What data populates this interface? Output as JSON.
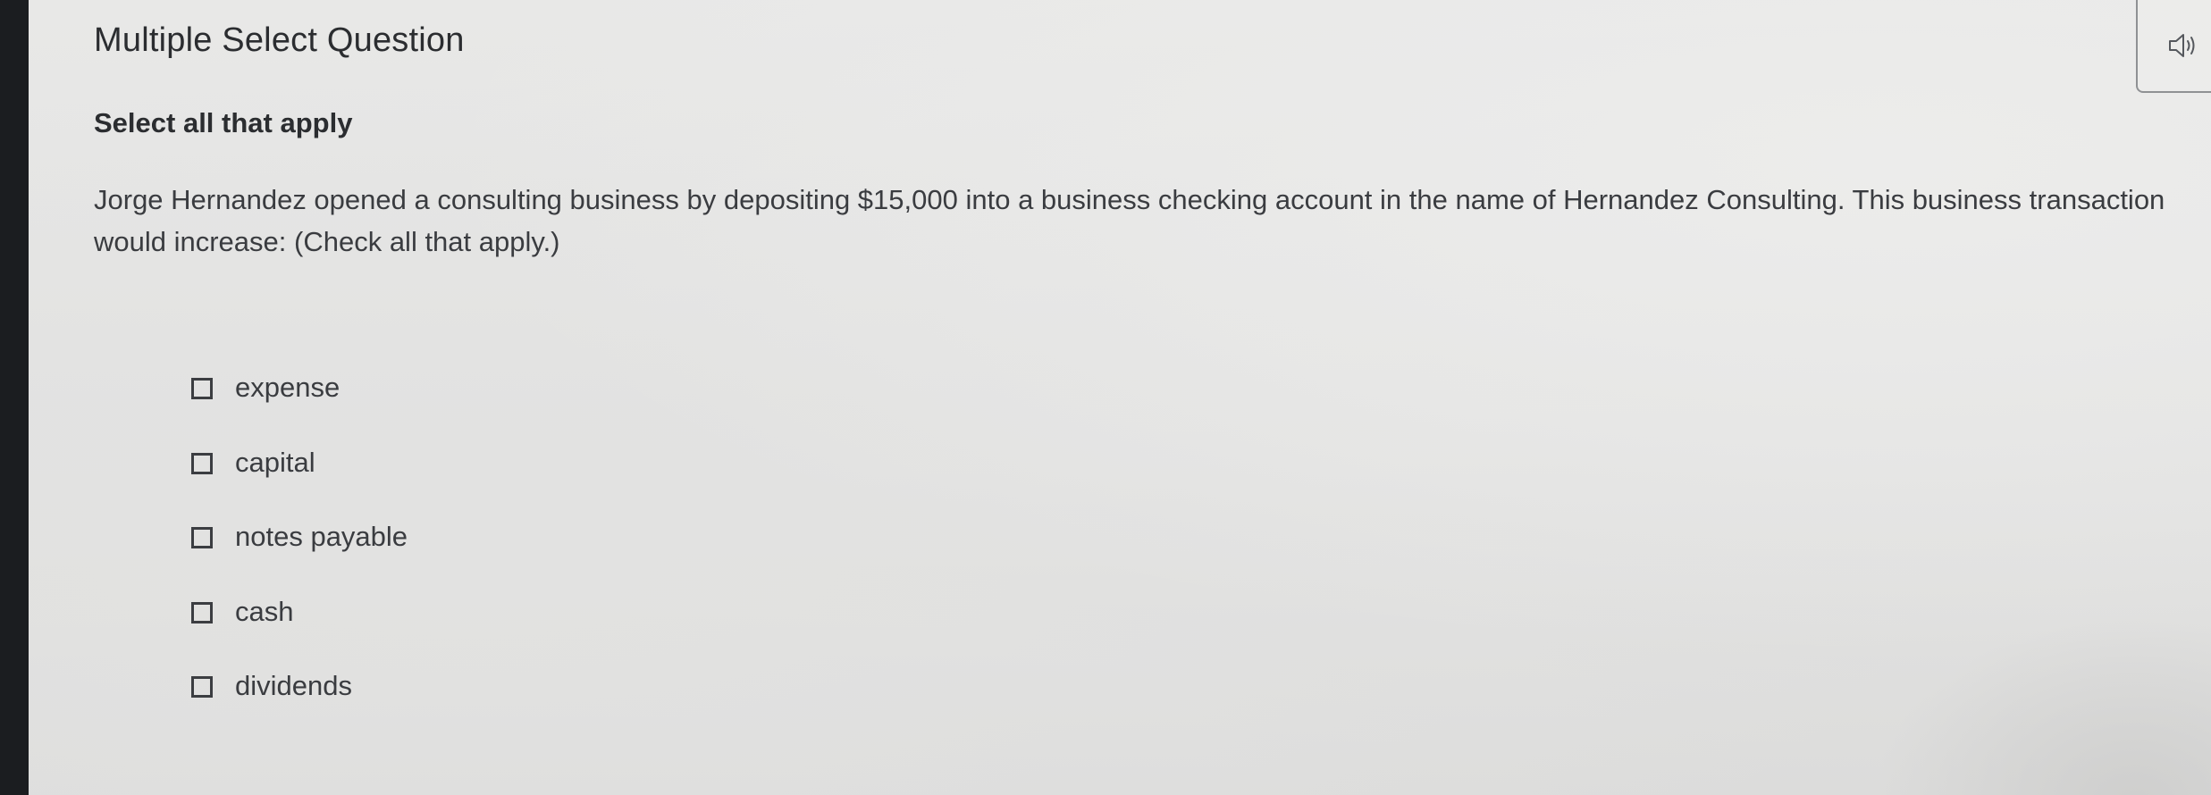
{
  "question": {
    "type_label": "Multiple Select Question",
    "instruction": "Select all that apply",
    "prompt": "Jorge Hernandez opened a consulting business by depositing $15,000 into a business checking account in the name of Hernandez Consulting. This business transaction would increase: (Check all that apply.)"
  },
  "audio": {
    "icon": "speaker-icon"
  },
  "options": [
    {
      "label": "expense",
      "checked": false
    },
    {
      "label": "capital",
      "checked": false
    },
    {
      "label": "notes payable",
      "checked": false
    },
    {
      "label": "cash",
      "checked": false
    },
    {
      "label": "dividends",
      "checked": false
    }
  ],
  "colors": {
    "text": "#2b2d30",
    "body_text": "#3a3c40",
    "background": "#e4e4e3",
    "bezel": "#1b1d20"
  }
}
